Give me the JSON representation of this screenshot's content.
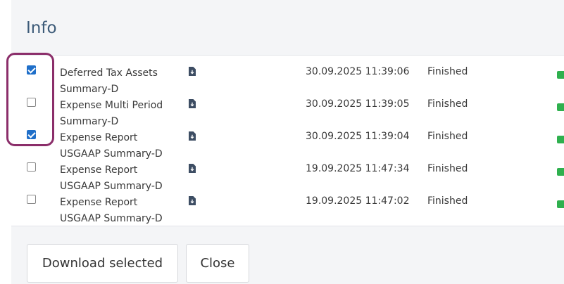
{
  "dialog": {
    "title": "Info"
  },
  "rows": [
    {
      "checked": true,
      "name": "Deferred Tax Assets Summary-D",
      "date": "30.09.2025 11:39:06",
      "status": "Finished"
    },
    {
      "checked": false,
      "name": "Expense Multi Period Summary-D",
      "date": "30.09.2025 11:39:05",
      "status": "Finished"
    },
    {
      "checked": true,
      "name": "Expense Report USGAAP Summary-D",
      "date": "30.09.2025 11:39:04",
      "status": "Finished"
    },
    {
      "checked": false,
      "name": "Expense Report USGAAP Summary-D",
      "date": "19.09.2025 11:47:34",
      "status": "Finished"
    },
    {
      "checked": false,
      "name": "Expense Report USGAAP Summary-D",
      "date": "19.09.2025 11:47:02",
      "status": "Finished"
    }
  ],
  "footer": {
    "download_label": "Download selected",
    "close_label": "Close"
  },
  "colors": {
    "accent": "#1f6fc9",
    "title": "#3c5a78",
    "highlight": "#8b2e6a",
    "success": "#2fb04e"
  },
  "icons": {
    "file": "file-download-icon",
    "status": "success-icon"
  }
}
